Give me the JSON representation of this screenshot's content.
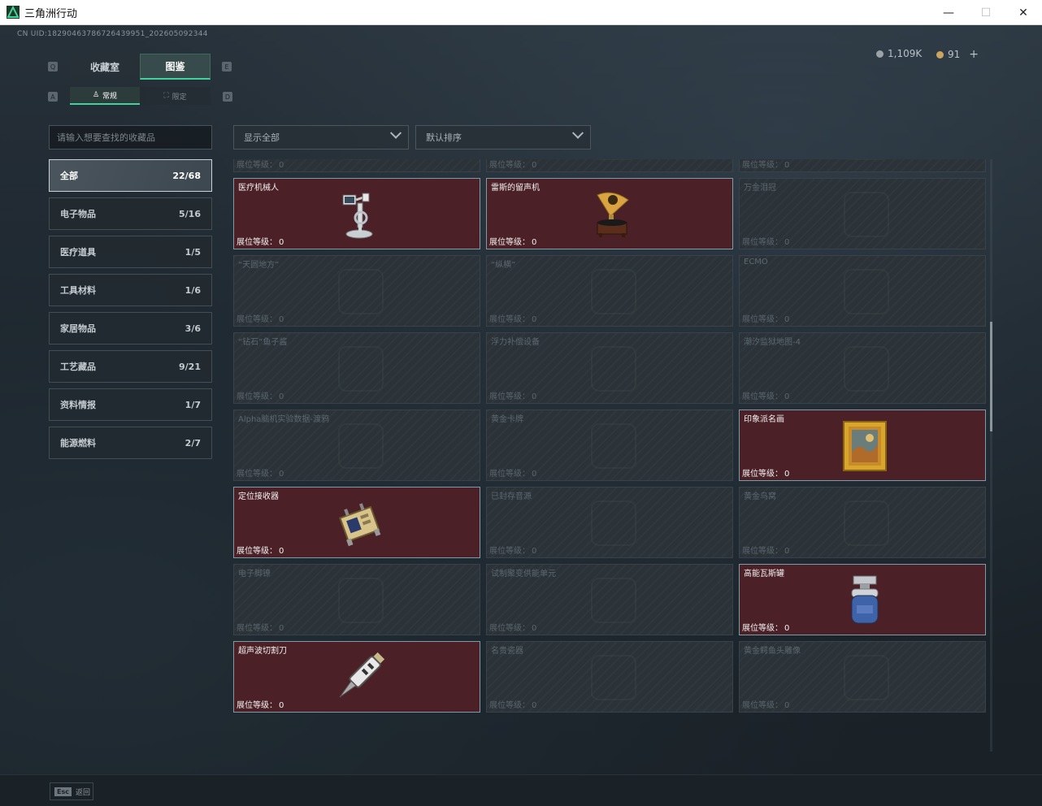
{
  "window": {
    "title": "三角洲行动",
    "minimize_glyph": "—",
    "maximize_glyph": "☐",
    "close_glyph": "✕"
  },
  "uid_text": "CN UID:18290463786726439951_202605092344",
  "currency": {
    "silver": "1,109K",
    "gold": "91",
    "add": "+"
  },
  "tabs": [
    {
      "label": "收藏室",
      "active": false
    },
    {
      "label": "图鉴",
      "active": true
    }
  ],
  "tab_nav": {
    "prev": "Q",
    "next": "E",
    "sub_prev": "A",
    "sub_next": "D"
  },
  "subtabs": [
    {
      "label": "常规",
      "active": true
    },
    {
      "label": "限定",
      "active": false
    }
  ],
  "search": {
    "placeholder": "请输入想要查找的收藏品",
    "value": ""
  },
  "filters": {
    "display": "显示全部",
    "sort": "默认排序"
  },
  "categories": [
    {
      "label": "全部",
      "count": "22/68",
      "active": true
    },
    {
      "label": "电子物品",
      "count": "5/16"
    },
    {
      "label": "医疗道具",
      "count": "1/5"
    },
    {
      "label": "工具材料",
      "count": "1/6"
    },
    {
      "label": "家居物品",
      "count": "3/6"
    },
    {
      "label": "工艺藏品",
      "count": "9/21"
    },
    {
      "label": "资料情报",
      "count": "1/7"
    },
    {
      "label": "能源燃料",
      "count": "2/7"
    }
  ],
  "level_label": "展位等级：",
  "items": [
    {
      "name": "",
      "level": "0",
      "collected": false
    },
    {
      "name": "",
      "level": "0",
      "collected": false
    },
    {
      "name": "",
      "level": "0",
      "collected": false
    },
    {
      "name": "医疗机械人",
      "level": "0",
      "collected": true,
      "icon": "medical-robot"
    },
    {
      "name": "雷斯的留声机",
      "level": "0",
      "collected": true,
      "icon": "gramophone"
    },
    {
      "name": "万金泪冠",
      "level": "0",
      "collected": false
    },
    {
      "name": "“天圆地方”",
      "level": "0",
      "collected": false
    },
    {
      "name": "“纵横”",
      "level": "0",
      "collected": false
    },
    {
      "name": "ECMO",
      "level": "0",
      "collected": false
    },
    {
      "name": "“钻石”鱼子酱",
      "level": "0",
      "collected": false
    },
    {
      "name": "浮力补偿设备",
      "level": "0",
      "collected": false
    },
    {
      "name": "潮汐监狱地图-4",
      "level": "0",
      "collected": false
    },
    {
      "name": "Alpha脑机实验数据-渡鸦",
      "level": "0",
      "collected": false
    },
    {
      "name": "黄金卡牌",
      "level": "0",
      "collected": false
    },
    {
      "name": "印象派名画",
      "level": "0",
      "collected": true,
      "icon": "painting"
    },
    {
      "name": "定位接收器",
      "level": "0",
      "collected": true,
      "icon": "receiver"
    },
    {
      "name": "已封存音源",
      "level": "0",
      "collected": false
    },
    {
      "name": "黄金鸟窝",
      "level": "0",
      "collected": false
    },
    {
      "name": "电子脚镣",
      "level": "0",
      "collected": false
    },
    {
      "name": "试制聚变供能单元",
      "level": "0",
      "collected": false
    },
    {
      "name": "高能瓦斯罐",
      "level": "0",
      "collected": true,
      "icon": "gas-canister"
    },
    {
      "name": "超声波切割刀",
      "level": "0",
      "collected": true,
      "icon": "ultrasonic-cutter"
    },
    {
      "name": "名贵瓷器",
      "level": "0",
      "collected": false
    },
    {
      "name": "黄金鳄鱼头雕像",
      "level": "0",
      "collected": false
    }
  ],
  "footer": {
    "esc_key": "Esc",
    "esc_label": "返回"
  },
  "colors": {
    "accent": "#43d39a",
    "collected_bg": "#4b2026",
    "locked_bg": "#2b3339"
  }
}
